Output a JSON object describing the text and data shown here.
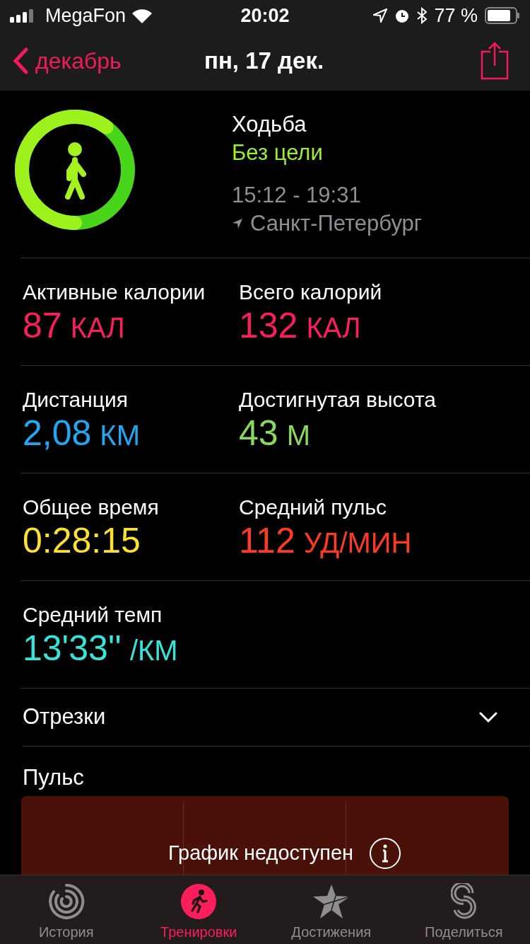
{
  "status_bar": {
    "carrier": "MegaFon",
    "time": "20:02",
    "battery": "77 %"
  },
  "nav": {
    "back": "декабрь",
    "title": "пн, 17 дек."
  },
  "workout": {
    "name": "Ходьба",
    "goal": "Без цели",
    "time_range": "15:12 - 19:31",
    "location": "Санкт-Петербург"
  },
  "metrics": [
    {
      "label": "Активные калории",
      "value": "87",
      "unit": "КАЛ",
      "color": "#fa1e5a"
    },
    {
      "label": "Всего калорий",
      "value": "132",
      "unit": "КАЛ",
      "color": "#fa1e5a"
    },
    {
      "label": "Дистанция",
      "value": "2,08",
      "unit": "КМ",
      "color": "#1fa8f5"
    },
    {
      "label": "Достигнутая высота",
      "value": "43",
      "unit": "М",
      "color": "#8ad85c"
    },
    {
      "label": "Общее время",
      "value": "0:28:15",
      "color": "#ffe02a"
    },
    {
      "label": "Средний пульс",
      "value": "112",
      "unit": "УД/МИН",
      "color": "#ff3a24"
    },
    {
      "label": "Средний темп",
      "value": "13'33''",
      "unit": "/КМ",
      "color": "#33e6dc"
    }
  ],
  "segments": {
    "label": "Отрезки",
    "expanded": false
  },
  "heart_rate": {
    "label": "Пульс",
    "message": "График недоступен"
  },
  "tabs": [
    {
      "label": "История",
      "kind": "rings",
      "selected": false
    },
    {
      "label": "Тренировки",
      "kind": "runner",
      "selected": true
    },
    {
      "label": "Достижения",
      "kind": "star",
      "selected": false
    },
    {
      "label": "Поделиться",
      "kind": "share",
      "selected": false
    }
  ]
}
